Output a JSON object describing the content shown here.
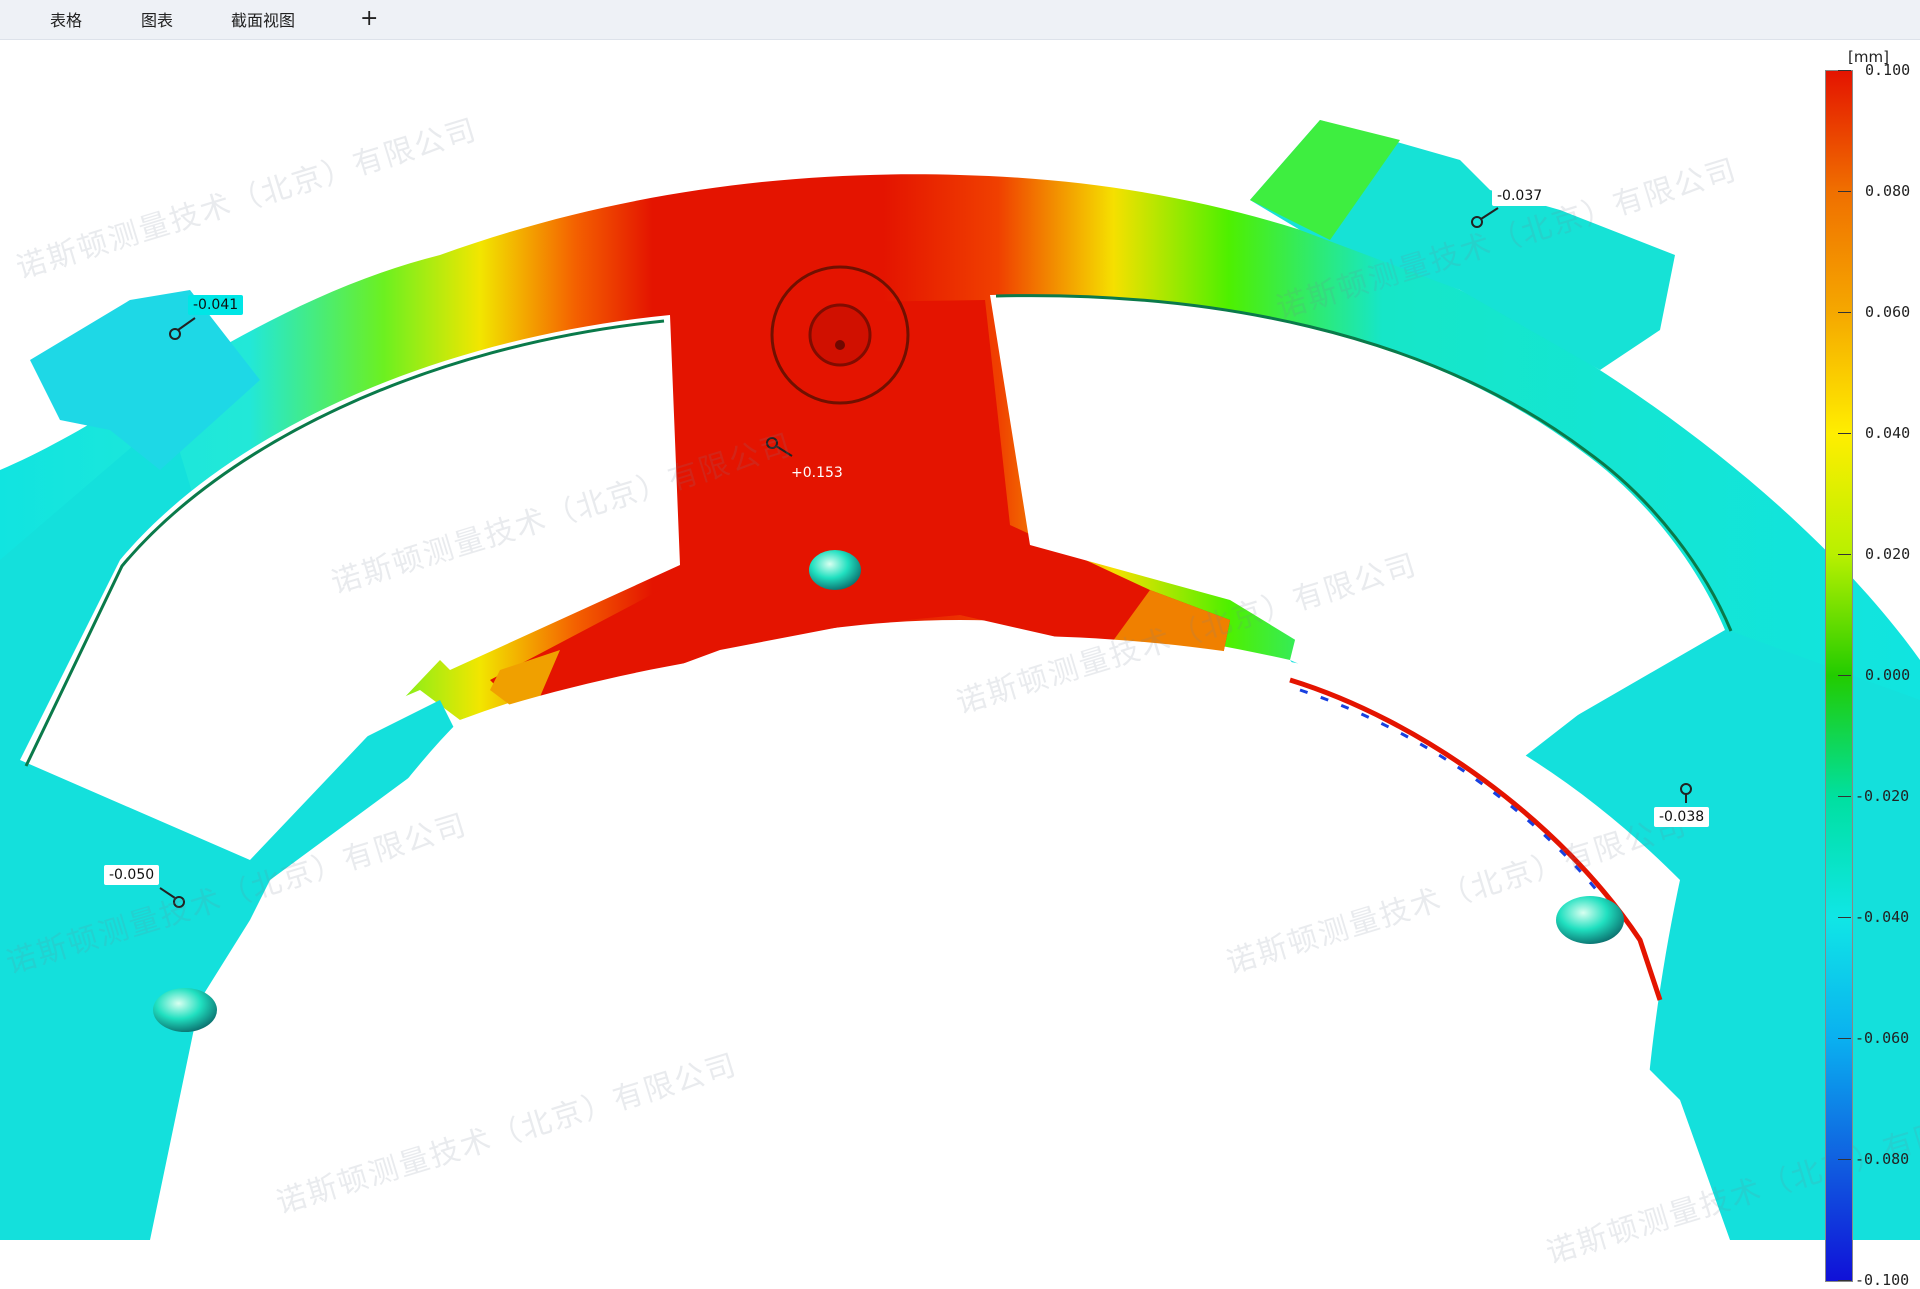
{
  "tabs": [
    {
      "label": "表格"
    },
    {
      "label": "图表"
    },
    {
      "label": "截面视图"
    }
  ],
  "add_tab_label": "+",
  "colorbar": {
    "unit": "[mm]",
    "labels": [
      "0.100",
      "0.080",
      "0.060",
      "0.040",
      "0.020",
      "0.000",
      "-0.020",
      "-0.040",
      "-0.060",
      "-0.080",
      "-0.100"
    ],
    "colors": [
      "#e41400",
      "#f07000",
      "#f5a800",
      "#ffee00",
      "#b8f000",
      "#22cc00",
      "#00e0a0",
      "#10e6e6",
      "#0ab0f0",
      "#1060e0",
      "#1010d8"
    ]
  },
  "callouts": [
    {
      "label": "-0.041",
      "color": "#00e6e6"
    },
    {
      "label": "-0.037",
      "color": "#ffffff"
    },
    {
      "label": "+0.153",
      "color": "#e41400"
    },
    {
      "label": "-0.050",
      "color": "#ffffff"
    },
    {
      "label": "-0.038",
      "color": "#ffffff"
    }
  ],
  "watermark": "诺斯顿测量技术（北京）有限公司",
  "colors": {
    "red": "#e41400",
    "cyan": "#11e4e0",
    "green": "#5ef000",
    "yellow": "#ffea00"
  }
}
